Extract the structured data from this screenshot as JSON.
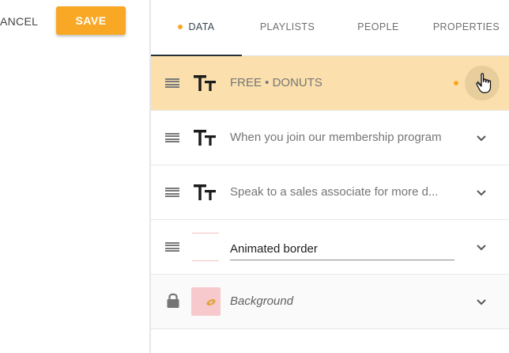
{
  "toolbar": {
    "cancel_label": "ANCEL",
    "save_label": "SAVE"
  },
  "colors": {
    "accent": "#f9a825",
    "highlight_row": "#fbe0ad",
    "tab_active": "#263238"
  },
  "tabs": [
    {
      "label": "DATA",
      "active": true,
      "has_dot": true
    },
    {
      "label": "PLAYLISTS",
      "active": false
    },
    {
      "label": "PEOPLE",
      "active": false
    },
    {
      "label": "PROPERTIES",
      "active": false
    }
  ],
  "rows": [
    {
      "type": "text",
      "icon": "text-format-icon",
      "label": "FREE • DONUTS",
      "highlighted": true,
      "has_status_dot": true
    },
    {
      "type": "text",
      "icon": "text-format-icon",
      "label": "When you join our membership program"
    },
    {
      "type": "text",
      "icon": "text-format-icon",
      "label": "Speak to a sales associate for more d..."
    },
    {
      "type": "media",
      "icon": "border-thumbnail",
      "value": "Animated border"
    },
    {
      "type": "locked",
      "icon": "lock-icon",
      "label": "Background"
    }
  ]
}
